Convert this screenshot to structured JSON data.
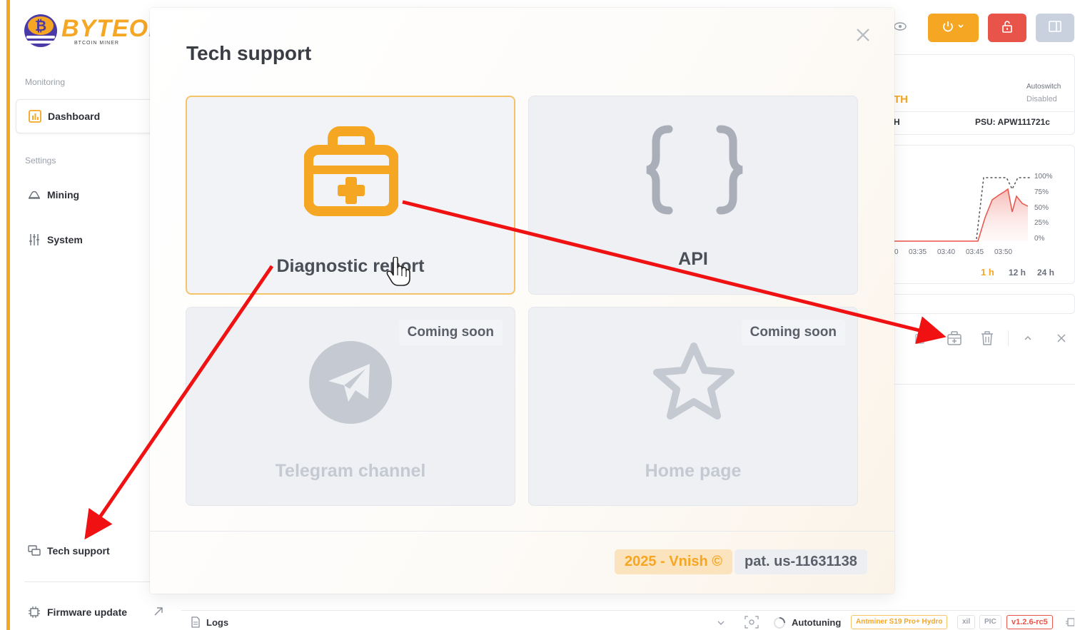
{
  "brand": {
    "name": "BYTEON",
    "subtitle": "BTCOIN MINER"
  },
  "sidebar": {
    "monitoring_label": "Monitoring",
    "settings_label": "Settings",
    "items": [
      {
        "label": "Dashboard",
        "icon": "bar-chart-icon",
        "active": true
      },
      {
        "label": "Mining",
        "icon": "pickaxe-icon"
      },
      {
        "label": "System",
        "icon": "sliders-icon"
      }
    ],
    "tech_support": {
      "label": "Tech support",
      "icon": "chat-bubbles-icon"
    },
    "firmware_update": {
      "label": "Firmware update",
      "icon": "chip-icon",
      "external_icon": "external-link-icon"
    }
  },
  "header": {
    "buttons": [
      {
        "name": "eye-toggle",
        "icon": "eye-icon"
      },
      {
        "name": "power-menu",
        "icon": "power-icon",
        "color": "#f5a623"
      },
      {
        "name": "lock",
        "icon": "unlock-icon",
        "color": "#e8534a"
      },
      {
        "name": "panel-toggle",
        "icon": "panel-icon",
        "color": "#c9d1de"
      }
    ]
  },
  "background_dashboard": {
    "hashrate_fragment": "TH",
    "hash_unit_fragment": "H",
    "autoswitch_label": "Autoswitch",
    "autoswitch_value": "Disabled",
    "psu_label": "PSU: APW111721c",
    "chart": {
      "y_ticks": [
        "100%",
        "75%",
        "50%",
        "25%",
        "0%"
      ],
      "x_ticks": [
        "0",
        "03:35",
        "03:40",
        "03:45",
        "03:50"
      ],
      "ranges": [
        "1 h",
        "12 h",
        "24 h"
      ],
      "active_range": "1 h"
    },
    "toolbar_icons": [
      "copy-icon",
      "first-aid-kit-icon",
      "trash-icon",
      "chevron-up-icon",
      "close-icon"
    ]
  },
  "statusbar": {
    "logs_label": "Logs",
    "autotuning_label": "Autotuning",
    "model": "Antminer S19 Pro+ Hydro",
    "badge_xil": "xil",
    "badge_pic": "PIC",
    "version": "v1.2.6-rc5"
  },
  "modal": {
    "title": "Tech support",
    "cards": [
      {
        "label": "Diagnostic report",
        "icon": "first-aid-kit-icon",
        "status": "",
        "accent": "#f5a623"
      },
      {
        "label": "API",
        "icon": "curly-braces-icon",
        "status": ""
      },
      {
        "label": "Telegram channel",
        "icon": "telegram-icon",
        "status": "Coming soon"
      },
      {
        "label": "Home page",
        "icon": "star-icon",
        "status": "Coming soon"
      }
    ],
    "footer": {
      "copyright": "2025 - Vnish ©",
      "patent": "pat. us-11631138"
    }
  },
  "colors": {
    "accent": "#f5a623",
    "danger": "#e8534a",
    "annotation_arrow": "#f01212"
  }
}
